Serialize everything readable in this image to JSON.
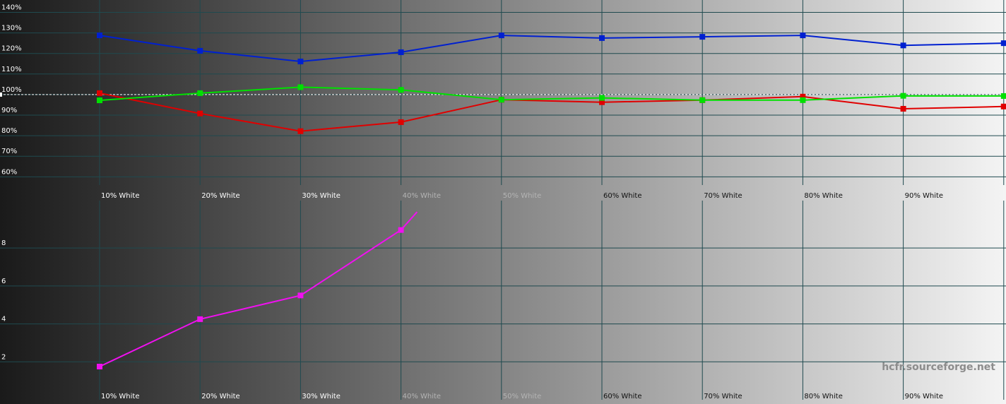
{
  "watermark": "hcfr.sourceforge.net",
  "colors": {
    "red": "#e00000",
    "green": "#00e000",
    "blue": "#0020d0",
    "magenta": "#f010f0",
    "grid": "#1f4a4f",
    "reference": "#ffffff"
  },
  "chart_data": [
    {
      "type": "line",
      "title": "",
      "xlabel": "",
      "ylabel": "",
      "categories": [
        "10% White",
        "20% White",
        "30% White",
        "40% White",
        "50% White",
        "60% White",
        "70% White",
        "80% White",
        "90% White",
        ""
      ],
      "yticks": [
        "60%",
        "70%",
        "80%",
        "90%",
        "100%",
        "110%",
        "120%",
        "130%",
        "140%"
      ],
      "ylim": [
        56,
        146
      ],
      "reference_line": 100,
      "grid": true,
      "series": [
        {
          "color": "red",
          "values": [
            100.7,
            90.8,
            82.2,
            86.6,
            97.5,
            96.3,
            97.3,
            99.0,
            93.1,
            94.2
          ]
        },
        {
          "color": "green",
          "values": [
            97.2,
            100.7,
            103.6,
            102.3,
            97.5,
            98.4,
            97.3,
            97.3,
            99.4,
            99.3
          ]
        },
        {
          "color": "blue",
          "values": [
            128.8,
            121.3,
            116.1,
            120.6,
            128.8,
            127.5,
            128.1,
            128.8,
            123.9,
            125.0
          ]
        }
      ]
    },
    {
      "type": "line",
      "title": "",
      "xlabel": "",
      "ylabel": "",
      "categories": [
        "10% White",
        "20% White",
        "30% White",
        "40% White",
        "50% White",
        "60% White",
        "70% White",
        "80% White",
        "90% White",
        ""
      ],
      "yticks": [
        "2",
        "4",
        "6",
        "8"
      ],
      "ylim": [
        0,
        10.5
      ],
      "grid": true,
      "series": [
        {
          "color": "magenta",
          "x_index": [
            0,
            1,
            2,
            3,
            3.16
          ],
          "values": [
            1.75,
            4.25,
            5.5,
            8.95,
            9.9
          ]
        }
      ]
    }
  ]
}
